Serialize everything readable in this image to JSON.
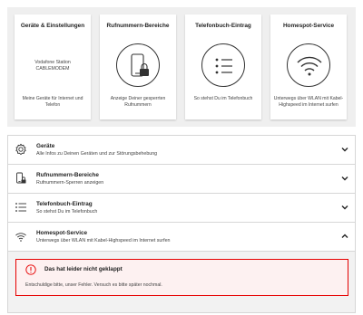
{
  "tiles": [
    {
      "title": "Geräte & Einstellungen",
      "device_line1": "Vodafone Station",
      "device_line2": "CABLEMODEM",
      "desc_line1": "Meine Geräte für Internet und",
      "desc_line2": "Telefon"
    },
    {
      "title": "Rufnummern-Bereiche",
      "icon": "phone-lock-icon",
      "desc_line1": "Anzeige Deiner gesperrten",
      "desc_line2": "Rufnummern"
    },
    {
      "title": "Telefonbuch-Eintrag",
      "icon": "list-icon",
      "desc_line1": "So stehst Du im Telefonbuch",
      "desc_line2": ""
    },
    {
      "title": "Homespot-Service",
      "icon": "wifi-icon",
      "desc_line1": "Unterwegs über WLAN mit Kabel-",
      "desc_line2": "Highspeed im Internet surfen"
    }
  ],
  "accordion": [
    {
      "title": "Geräte",
      "subtitle": "Alle Infos zu Deinen Geräten und zur Störungsbehebung",
      "icon": "gear-icon",
      "expanded": false
    },
    {
      "title": "Rufnummern-Bereiche",
      "subtitle": "Rufnummern-Sperren anzeigen",
      "icon": "phone-lock-icon",
      "expanded": false
    },
    {
      "title": "Telefonbuch-Eintrag",
      "subtitle": "So stehst Du im Telefonbuch",
      "icon": "list-icon",
      "expanded": false
    },
    {
      "title": "Homespot-Service",
      "subtitle": "Unterwegs über WLAN mit Kabel-Highspeed im Internet surfen",
      "icon": "wifi-icon",
      "expanded": true
    }
  ],
  "error": {
    "title": "Das hat leider nicht geklappt",
    "message": "Entschuldige bitte, unser Fehler. Versuch es bitte später nochmal."
  },
  "colors": {
    "accent": "#e60000",
    "panel_bg": "#efefef",
    "error_bg": "#fdf1f1"
  }
}
